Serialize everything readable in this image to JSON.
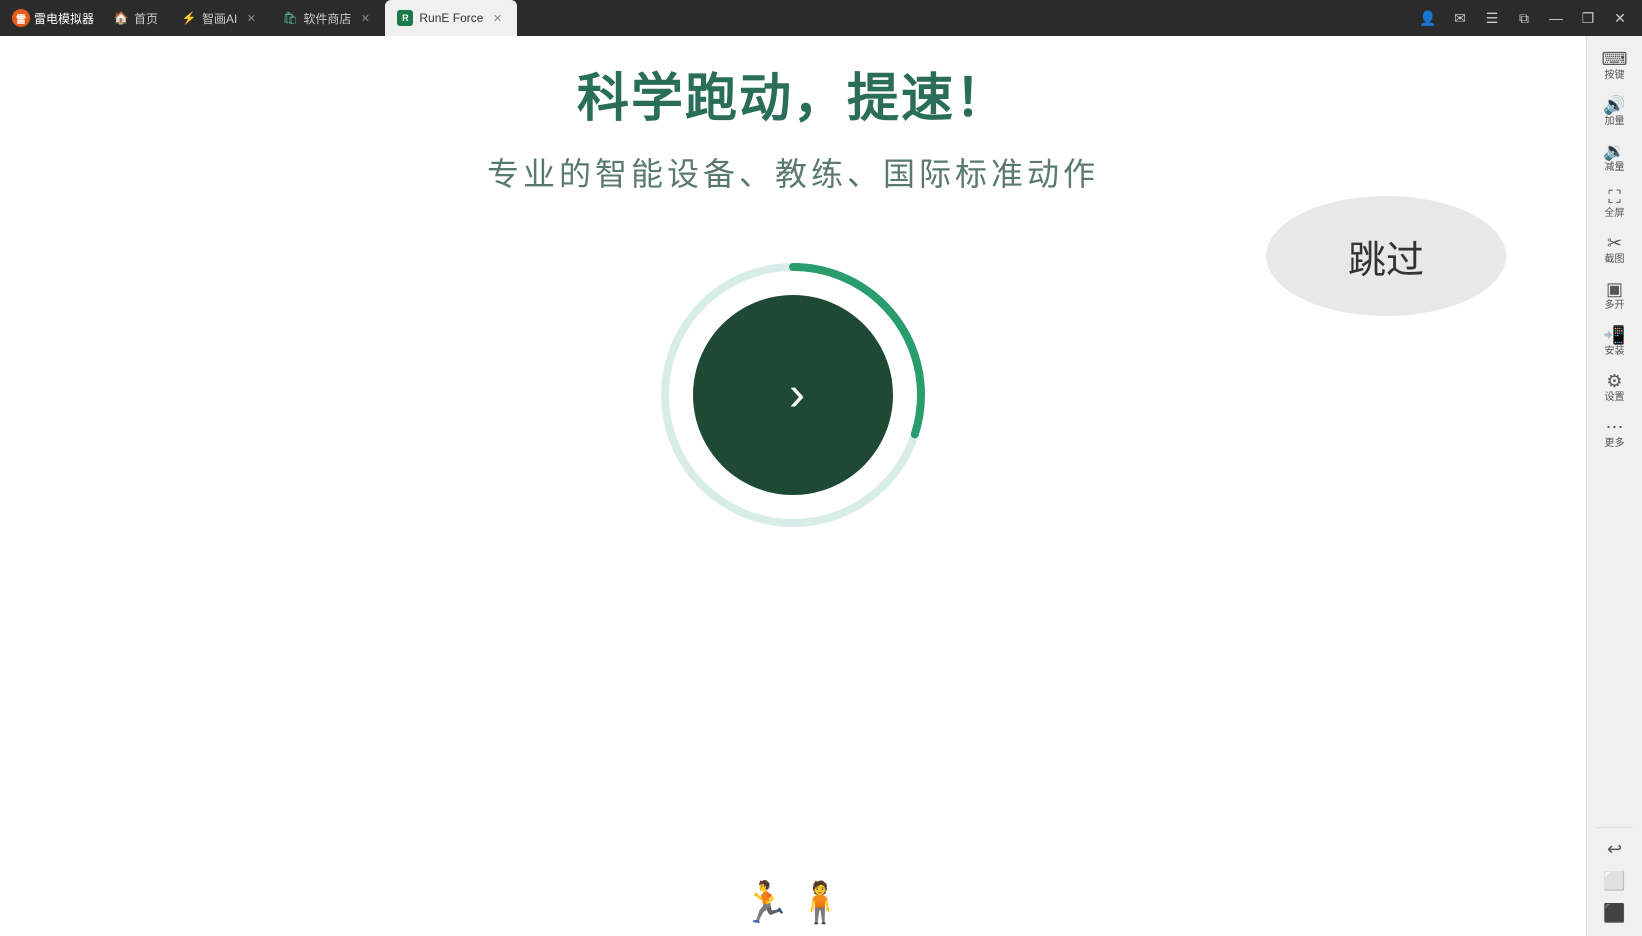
{
  "titlebar": {
    "app_name": "雷电模拟器",
    "tabs": [
      {
        "id": "home",
        "label": "首页",
        "icon": "🏠",
        "active": false,
        "closable": false
      },
      {
        "id": "ai",
        "label": "智画AI",
        "icon": "⚡",
        "active": false,
        "closable": true
      },
      {
        "id": "store",
        "label": "软件商店",
        "icon": "🛍",
        "active": false,
        "closable": true
      },
      {
        "id": "rune",
        "label": "RunE Force",
        "icon": "R",
        "active": true,
        "closable": true
      }
    ],
    "window_controls": {
      "minimize": "—",
      "restore": "❐",
      "close": "✕"
    }
  },
  "right_sidebar": {
    "items": [
      {
        "id": "buttons",
        "icon": "⌨",
        "label": "按键"
      },
      {
        "id": "volume_up",
        "icon": "🔊",
        "label": "加量"
      },
      {
        "id": "volume_down",
        "icon": "🔉",
        "label": "减量"
      },
      {
        "id": "fullscreen",
        "icon": "⛶",
        "label": "全屏"
      },
      {
        "id": "screenshot",
        "icon": "✂",
        "label": "截图"
      },
      {
        "id": "multi_open",
        "icon": "▣",
        "label": "多开"
      },
      {
        "id": "install",
        "icon": "📲",
        "label": "安装"
      },
      {
        "id": "settings",
        "icon": "⚙",
        "label": "设置"
      },
      {
        "id": "more",
        "icon": "⋯",
        "label": "更多"
      }
    ],
    "bottom_items": [
      {
        "id": "back",
        "icon": "↩",
        "label": ""
      },
      {
        "id": "home_btn",
        "icon": "⬜",
        "label": ""
      },
      {
        "id": "recent",
        "icon": "⬛",
        "label": ""
      }
    ]
  },
  "app": {
    "headline": "科学跑动，提速！",
    "subtitle": "专业的智能设备、教练、国际标准动作",
    "skip_label": "跳过",
    "next_button_label": "›",
    "progress_percent": 30,
    "circle_track_color": "#d8ede7",
    "circle_fill_color": "#2a9d6f",
    "circle_bg_color": "#1e4a35"
  }
}
